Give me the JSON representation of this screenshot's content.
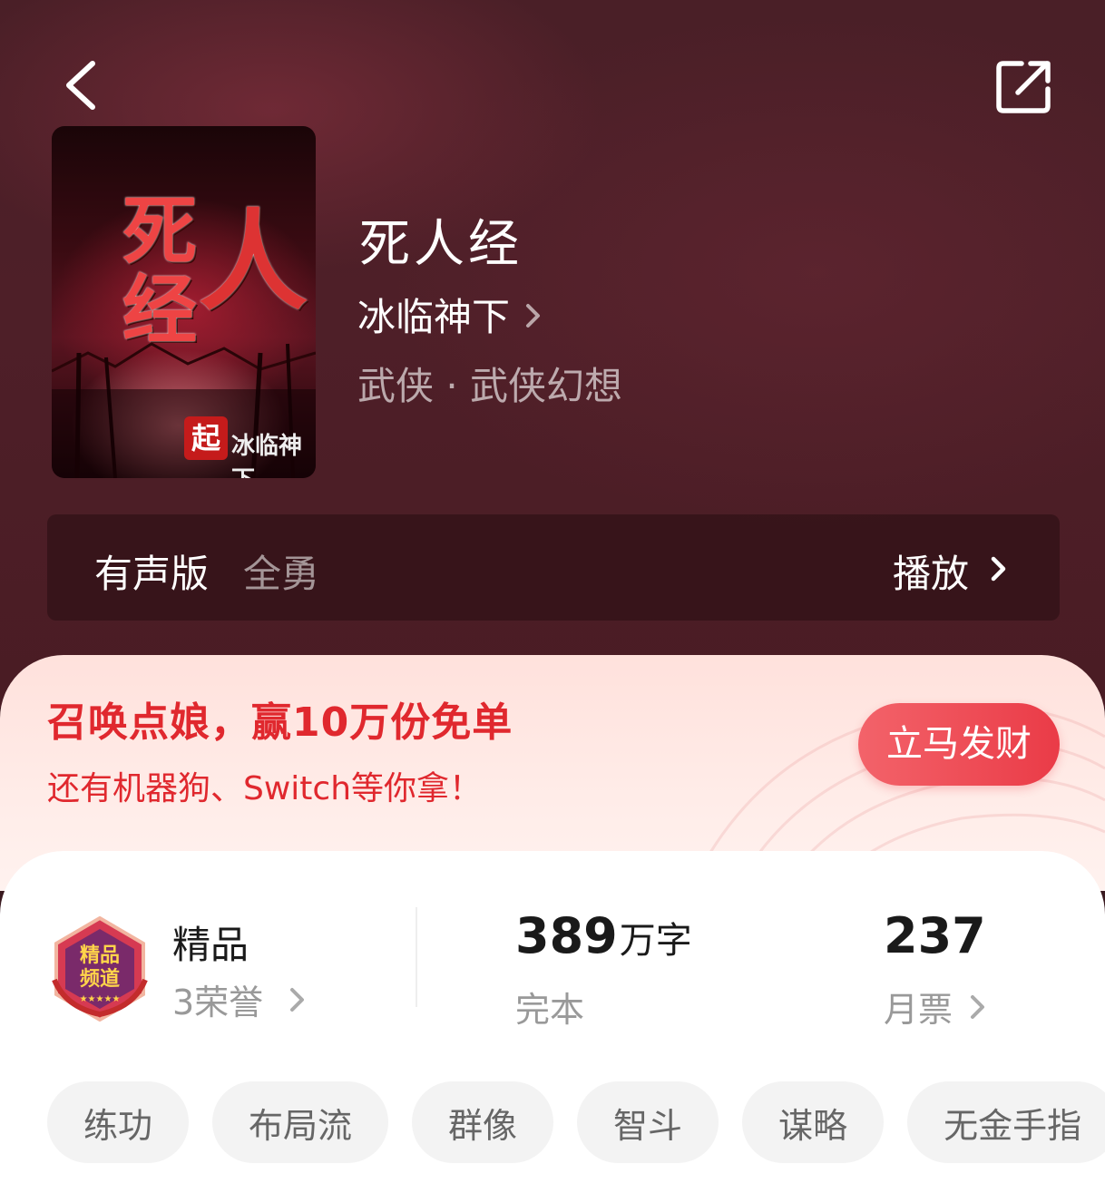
{
  "book": {
    "title": "死人经",
    "author": "冰临神下",
    "genre": "武侠 · 武侠幻想",
    "cover": {
      "title_chars": [
        "死",
        "经",
        "人"
      ],
      "author": "冰临神下",
      "logo": "起"
    }
  },
  "audio": {
    "label": "有声版",
    "narrator": "全勇",
    "play_label": "播放"
  },
  "promo": {
    "title": "召唤点娘，赢10万份免单",
    "subtitle": "还有机器狗、Switch等你拿！",
    "button_label": "立马发财"
  },
  "stats": {
    "quality": "精品",
    "honors": "3荣誉",
    "word_count": "389",
    "word_unit": "万字",
    "status": "完本",
    "monthly_tickets": "237",
    "monthly_tickets_label": "月票"
  },
  "tags": [
    "练功",
    "布局流",
    "群像",
    "智斗",
    "谋略",
    "无金手指"
  ],
  "icons": {
    "back": "chevron-left-icon",
    "share": "share-icon",
    "badge": "premium-channel-badge"
  },
  "colors": {
    "accent_red": "#e0282e",
    "button_red": "#ea3b47",
    "hero_bg": "#4a1f27"
  }
}
